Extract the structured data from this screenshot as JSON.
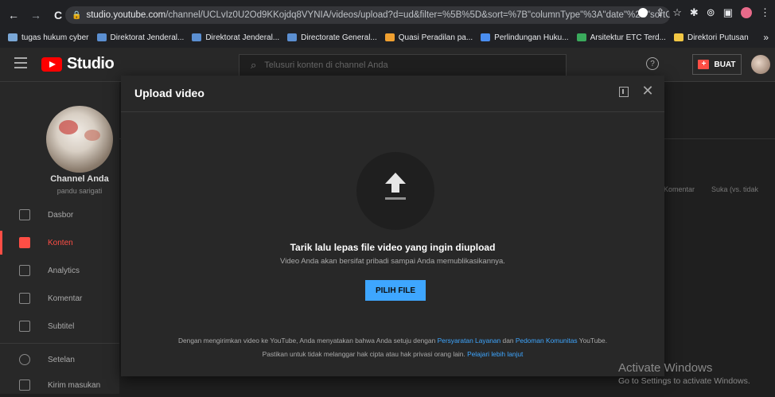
{
  "browser": {
    "url_host": "studio.youtube.com",
    "url_path": "/channel/UCLvIz0U2Od9KKojdq8VYNIA/videos/upload?d=ud&filter=%5B%5D&sort=%7B\"columnType\"%3A\"date\"%2C\"sortOrder\"%...",
    "bookmarks": [
      {
        "label": "tugas hukum cyber",
        "color": "#7aa7d6"
      },
      {
        "label": "Direktorat Jenderal...",
        "color": "#5b8fd1"
      },
      {
        "label": "Direktorat Jenderal...",
        "color": "#5b8fd1"
      },
      {
        "label": "Directorate General...",
        "color": "#5b8fd1"
      },
      {
        "label": "Quasi Peradilan pa...",
        "color": "#f0a030"
      },
      {
        "label": "Perlindungan Huku...",
        "color": "#4a8ef0"
      },
      {
        "label": "Arsitektur ETC Terd...",
        "color": "#3aaa5c"
      },
      {
        "label": "Direktori Putusan",
        "color": "#f2c744"
      }
    ],
    "more": "»"
  },
  "header": {
    "logo_text": "Studio",
    "search_placeholder": "Telusuri konten di channel Anda",
    "help": "?",
    "create_label": "BUAT"
  },
  "sidebar": {
    "channel_name": "Channel Anda",
    "channel_handle": "pandu sarigati",
    "items": [
      {
        "label": "Dasbor",
        "active": false
      },
      {
        "label": "Konten",
        "active": true
      },
      {
        "label": "Analytics",
        "active": false
      },
      {
        "label": "Komentar",
        "active": false
      },
      {
        "label": "Subtitel",
        "active": false
      },
      {
        "label": "Setelan",
        "active": false
      },
      {
        "label": "Kirim masukan",
        "active": false
      }
    ]
  },
  "background": {
    "col_comments": "Komentar",
    "col_likes": "Suka (vs. tidak"
  },
  "modal": {
    "title": "Upload video",
    "close": "✕",
    "drop_text": "Tarik lalu lepas file video yang ingin diupload",
    "privacy_note": "Video Anda akan bersifat pribadi sampai Anda memublikasikannya.",
    "select_button": "PILIH FILE",
    "legal1_prefix": "Dengan mengirimkan video ke YouTube, Anda menyatakan bahwa Anda setuju dengan",
    "legal1_link1": "Persyaratan Layanan",
    "legal1_mid": "dan",
    "legal1_link2": "Pedoman Komunitas",
    "legal1_suffix": "YouTube.",
    "legal2_prefix": "Pastikan untuk tidak melanggar hak cipta atau hak privasi orang lain.",
    "legal2_link": "Pelajari lebih lanjut"
  },
  "watermark": {
    "title": "Activate Windows",
    "subtitle": "Go to Settings to activate Windows."
  }
}
